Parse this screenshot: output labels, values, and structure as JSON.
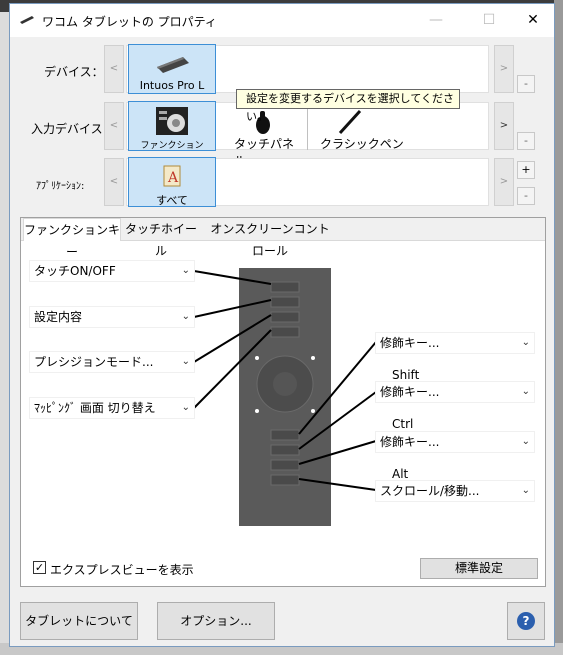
{
  "window": {
    "title": "ワコム タブレットの プロパティ",
    "minimize": "—",
    "maximize": "☐",
    "close": "✕"
  },
  "rows": {
    "device": {
      "label": "デバイス：",
      "selected": "Intuos Pro L"
    },
    "input": {
      "label": "入力デバイス:",
      "items": [
        "ファンクション",
        "タッチパネル",
        "クラシックペン"
      ]
    },
    "app": {
      "label": "ｱﾌﾟﾘｹｰｼｮﾝ:",
      "selected": "すべて"
    }
  },
  "nav": {
    "prev": "<",
    "next": ">",
    "add": "+",
    "remove": "-"
  },
  "tooltip": "設定を変更するデバイスを選択してください。",
  "tabs": [
    "ファンクションキー",
    "タッチホイール",
    "オンスクリーンコントロール"
  ],
  "left_dropdowns": [
    "タッチON/OFF",
    "設定内容",
    "プレシジョンモード...",
    "ﾏｯﾋﾟﾝｸﾞ 画面 切り替え"
  ],
  "right_dropdowns": [
    {
      "label": "修飾キー...",
      "sub": "Shift"
    },
    {
      "label": "修飾キー...",
      "sub": "Ctrl"
    },
    {
      "label": "修飾キー...",
      "sub": "Alt"
    },
    {
      "label": "スクロール/移動...",
      "sub": ""
    }
  ],
  "expressview": {
    "label": "エクスプレスビューを表示",
    "checked": "✓"
  },
  "default_button": "標準設定",
  "bottom": {
    "about": "タブレットについて",
    "options": "オプション...",
    "help": "?"
  },
  "colors": {
    "accent": "#3d8fd6",
    "tile_bg": "#cce4f7",
    "tablet": "#5a5a5a"
  }
}
